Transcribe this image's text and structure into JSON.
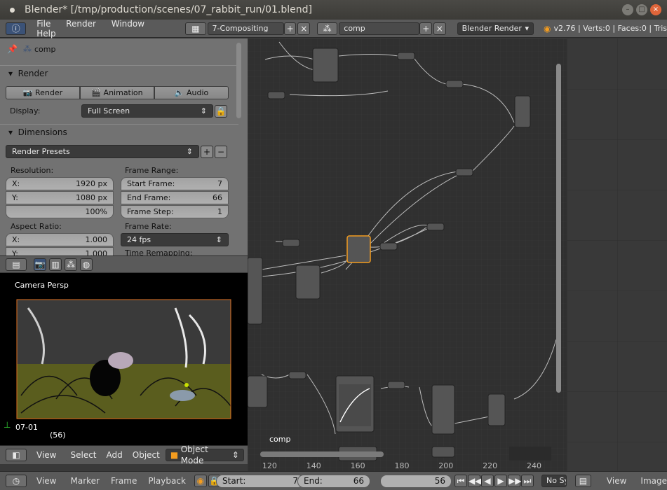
{
  "window": {
    "title": "Blender* [/tmp/production/scenes/07_rabbit_run/01.blend]"
  },
  "menu": {
    "file": "File",
    "render": "Render",
    "window": "Window",
    "help": "Help"
  },
  "screen_layout": "7-Compositing",
  "scene": "comp",
  "engine": "Blender Render",
  "stats": "v2.76 | Verts:0 | Faces:0 | Tris",
  "props": {
    "context_name": "comp",
    "render": {
      "title": "Render",
      "render_btn": "Render",
      "animation_btn": "Animation",
      "audio_btn": "Audio",
      "display_label": "Display:",
      "display_value": "Full Screen"
    },
    "dimensions": {
      "title": "Dimensions",
      "presets": "Render Presets",
      "resolution_label": "Resolution:",
      "x_label": "X:",
      "x_value": "1920 px",
      "y_label": "Y:",
      "y_value": "1080 px",
      "percent": "100%",
      "aspect_label": "Aspect Ratio:",
      "ax_label": "X:",
      "ax_value": "1.000",
      "ay_label": "Y:",
      "ay_value": "1.000",
      "frame_range_label": "Frame Range:",
      "start_label": "Start Frame:",
      "start_value": "7",
      "end_label": "End Frame:",
      "end_value": "66",
      "step_label": "Frame Step:",
      "step_value": "1",
      "frame_rate_label": "Frame Rate:",
      "frame_rate_value": "24 fps",
      "time_remap_label": "Time Remapping:"
    }
  },
  "viewport": {
    "label": "Camera Persp",
    "object_name": "07-01",
    "frame": "(56)",
    "overlay_text": "comp"
  },
  "viewport_header": {
    "view": "View",
    "select": "Select",
    "add": "Add",
    "object": "Object",
    "mode": "Object Mode"
  },
  "node_ruler": [
    "120",
    "140",
    "160",
    "180",
    "200",
    "220",
    "240"
  ],
  "timeline": {
    "view": "View",
    "marker": "Marker",
    "frame": "Frame",
    "playback": "Playback",
    "start_label": "Start:",
    "start_value": "7",
    "end_label": "End:",
    "end_value": "66",
    "current": "56",
    "sync": "No Sy"
  },
  "image_header": {
    "view": "View",
    "image": "Image"
  },
  "colors": {
    "node_active": "#f39c1f",
    "panel": "#727272",
    "header": "#5a5a5a",
    "node_bg": "#303030"
  }
}
